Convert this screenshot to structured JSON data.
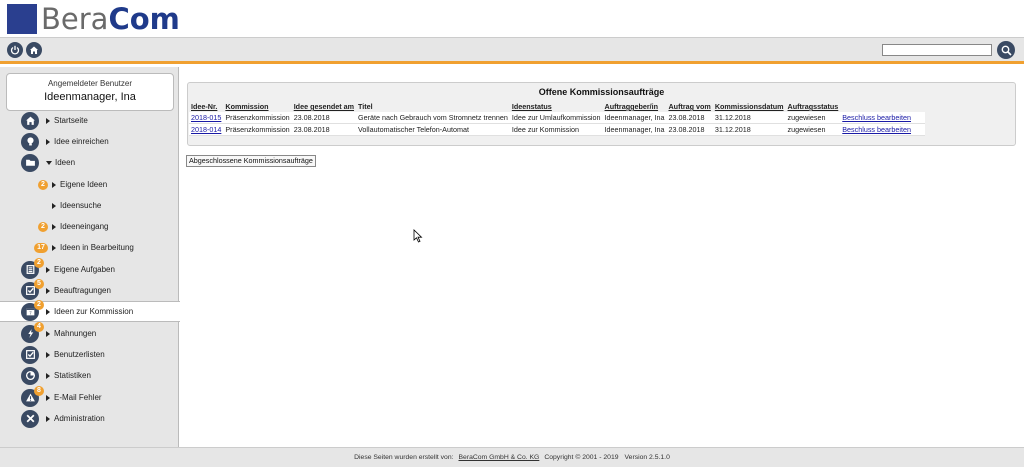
{
  "header": {
    "logo_part1": "Bera",
    "logo_part2": "Com"
  },
  "toolbar": {
    "search_placeholder": ""
  },
  "sidebar": {
    "user_caption": "Angemeldeter Benutzer",
    "user_name": "Ideenmanager, Ina",
    "items": [
      {
        "label": "Startseite",
        "icon": "home-icon"
      },
      {
        "label": "Idee einreichen",
        "icon": "lightbulb-icon"
      },
      {
        "label": "Ideen",
        "icon": "folder-icon"
      },
      {
        "label": "Eigene Ideen",
        "badge": "2"
      },
      {
        "label": "Ideensuche"
      },
      {
        "label": "Ideeneingang",
        "badge": "2"
      },
      {
        "label": "Ideen in Bearbeitung",
        "badge": "17"
      },
      {
        "label": "Eigene Aufgaben",
        "icon": "tasks-icon",
        "badge": "2"
      },
      {
        "label": "Beauftragungen",
        "icon": "check-icon",
        "badge": "5"
      },
      {
        "label": "Ideen zur Kommission",
        "icon": "calendar-icon",
        "badge": "2"
      },
      {
        "label": "Mahnungen",
        "icon": "alert-icon",
        "badge": "4"
      },
      {
        "label": "Benutzerlisten",
        "icon": "list-check-icon"
      },
      {
        "label": "Statistiken",
        "icon": "chart-icon"
      },
      {
        "label": "E-Mail Fehler",
        "icon": "warning-icon",
        "badge": "8"
      },
      {
        "label": "Administration",
        "icon": "tools-icon"
      }
    ]
  },
  "main": {
    "panel_title": "Offene Kommissionsaufträge",
    "columns": [
      "Idee-Nr.",
      "Kommission",
      "Idee gesendet am",
      "Titel",
      "Ideenstatus",
      "Auftraggeber/in",
      "Auftrag vom",
      "Kommissionsdatum",
      "Auftragsstatus",
      ""
    ],
    "rows": [
      [
        "2018-015",
        "Präsenzkommission",
        "23.08.2018",
        "Geräte nach Gebrauch vom Stromnetz trennen",
        "Idee zur Umlaufkommission",
        "Ideenmanager, Ina",
        "23.08.2018",
        "31.12.2018",
        "zugewiesen",
        "Beschluss bearbeiten"
      ],
      [
        "2018-014",
        "Präsenzkommission",
        "23.08.2018",
        "Vollautomatischer Telefon-Automat",
        "Idee zur Kommission",
        "Ideenmanager, Ina",
        "23.08.2018",
        "31.12.2018",
        "zugewiesen",
        "Beschluss bearbeiten"
      ]
    ],
    "closed_button": "Abgeschlossene Kommissionsaufträge"
  },
  "footer": {
    "created_by": "Diese Seiten wurden erstellt von:",
    "company": "BeraCom GmbH & Co. KG",
    "copyright": "Copyright © 2001 - 2019",
    "version": "Version  2.5.1.0"
  },
  "colors": {
    "accent": "#f0a030",
    "icon_bg": "#3a4a63",
    "brand": "#1f3a8a"
  }
}
